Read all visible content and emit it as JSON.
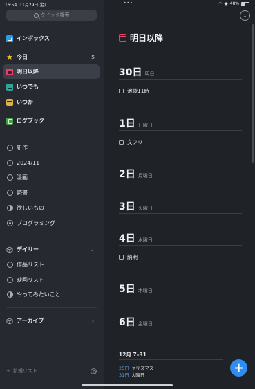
{
  "status_bar": {
    "time": "16:54",
    "date": "11月29日(金)",
    "battery_text": "48%",
    "battery_level": 0.48
  },
  "search": {
    "placeholder": "クイック検索"
  },
  "sidebar": {
    "top_items": [
      {
        "label": "インボックス",
        "icon": "inbox-icon"
      },
      {
        "label": "今日",
        "icon": "star-icon",
        "count": "5"
      },
      {
        "label": "明日以降",
        "icon": "calendar-icon",
        "active": true
      },
      {
        "label": "いつでも",
        "icon": "layers-icon"
      },
      {
        "label": "いつか",
        "icon": "archive-box-icon"
      },
      {
        "label": "ログブック",
        "icon": "logbook-icon"
      }
    ],
    "lists": [
      {
        "label": "新作",
        "icon": "empty-circle-icon"
      },
      {
        "label": "2024/11",
        "icon": "empty-circle-icon"
      },
      {
        "label": "漫画",
        "icon": "empty-circle-icon"
      },
      {
        "label": "読書",
        "icon": "progress-circle-icon"
      },
      {
        "label": "欲しいもの",
        "icon": "half-circle-icon"
      },
      {
        "label": "プログラミング",
        "icon": "dot-circle-icon"
      }
    ],
    "area_daily": {
      "label": "デイリー",
      "items": [
        {
          "label": "作品リスト",
          "icon": "progress-circle-icon"
        },
        {
          "label": "映画リスト",
          "icon": "empty-circle-icon"
        },
        {
          "label": "やってみたいこと",
          "icon": "half-circle-icon"
        }
      ]
    },
    "area_archive": {
      "label": "アーカイブ"
    },
    "new_list_label": "新規リスト"
  },
  "main": {
    "title": "明日以降",
    "days": [
      {
        "num": "30日",
        "label": "明日",
        "tasks": [
          "池袋11時"
        ]
      },
      {
        "num": "1日",
        "label": "日曜日",
        "tasks": [
          "文フリ"
        ]
      },
      {
        "num": "2日",
        "label": "月曜日",
        "tasks": []
      },
      {
        "num": "3日",
        "label": "火曜日",
        "tasks": []
      },
      {
        "num": "4日",
        "label": "水曜日",
        "tasks": [
          "納期"
        ]
      },
      {
        "num": "5日",
        "label": "木曜日",
        "tasks": []
      },
      {
        "num": "6日",
        "label": "金曜日",
        "tasks": []
      }
    ],
    "month_range": "12月 7–31",
    "holidays": [
      {
        "day": "25日",
        "name": "クリスマス"
      },
      {
        "day": "31日",
        "name": "大晦日"
      }
    ],
    "add_button": "+"
  },
  "colors": {
    "accent": "#2f8cf0",
    "calendar": "#e6416a",
    "star": "#f4c531",
    "inbox": "#2b9be6"
  }
}
